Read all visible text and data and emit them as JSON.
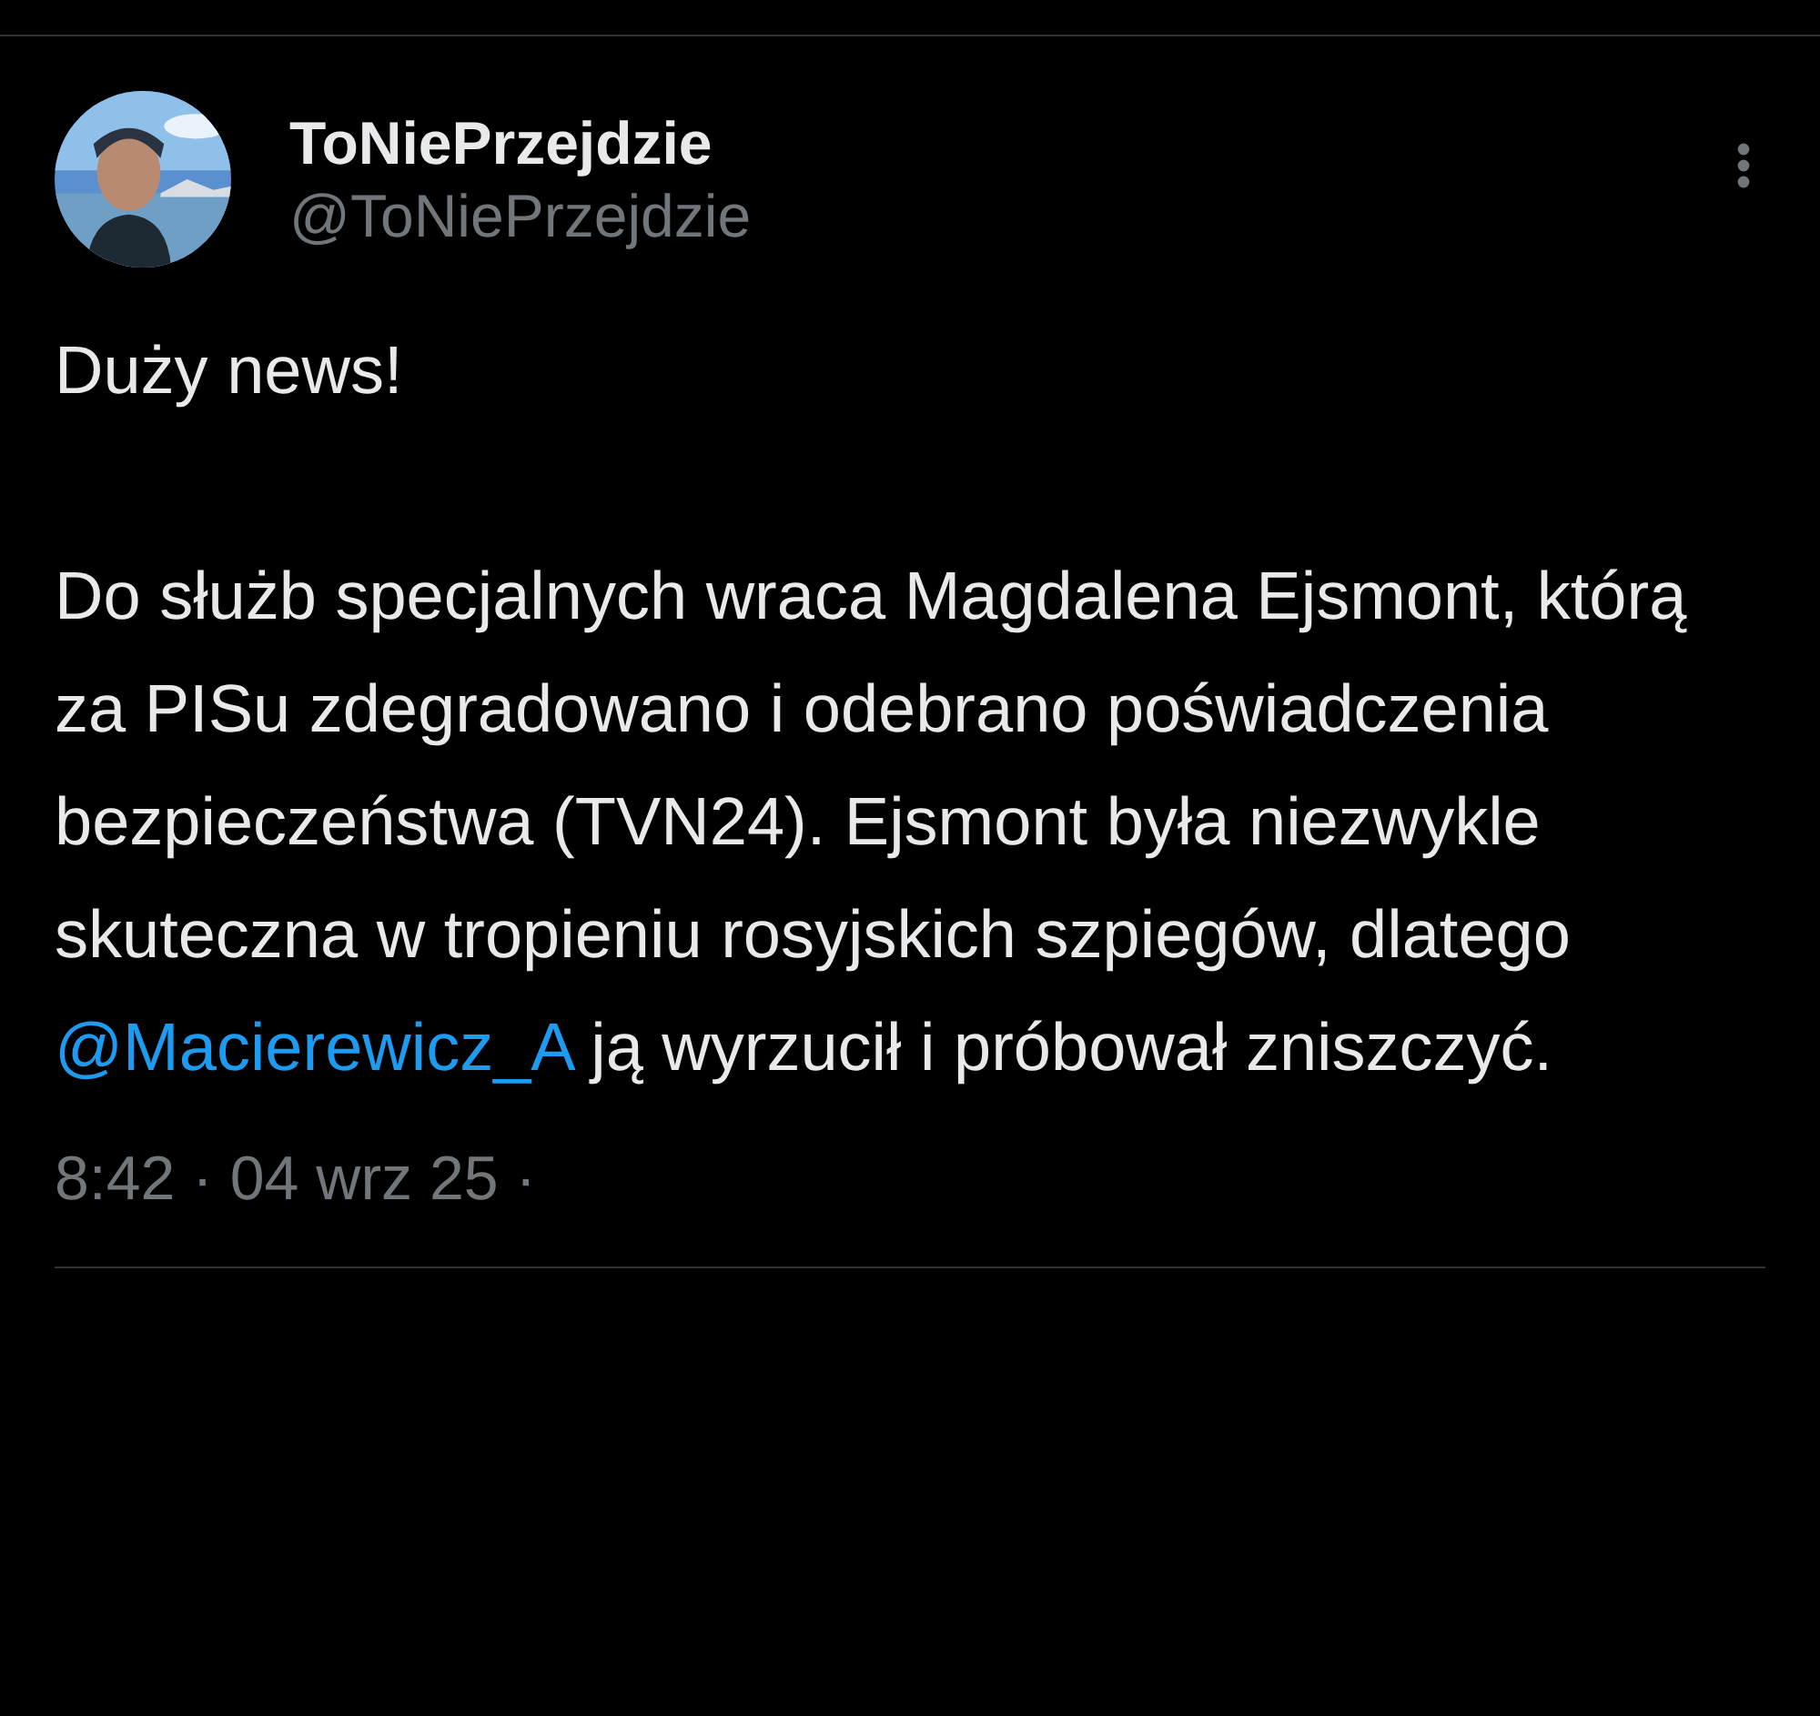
{
  "author": {
    "name": "ToNiePrzejdzie",
    "handle": "@ToNiePrzejdzie"
  },
  "body": {
    "headline": "Duży news!",
    "paragraph": [
      {
        "kind": "text",
        "text": "Do służb specjalnych wraca Magdalena Ejsmont, którą za PISu zdegradowano i odebrano poświadczenia bezpieczeństwa (TVN24). Ejsmont była niezwykle skuteczna w tropieniu rosyjskich szpiegów, dlatego "
      },
      {
        "kind": "mention",
        "text": "@Macierewicz_A"
      },
      {
        "kind": "text",
        "text": " ją wyrzucił i próbował zniszczyć."
      }
    ]
  },
  "timestamp": "8:42 · 04 wrz 25 ·"
}
